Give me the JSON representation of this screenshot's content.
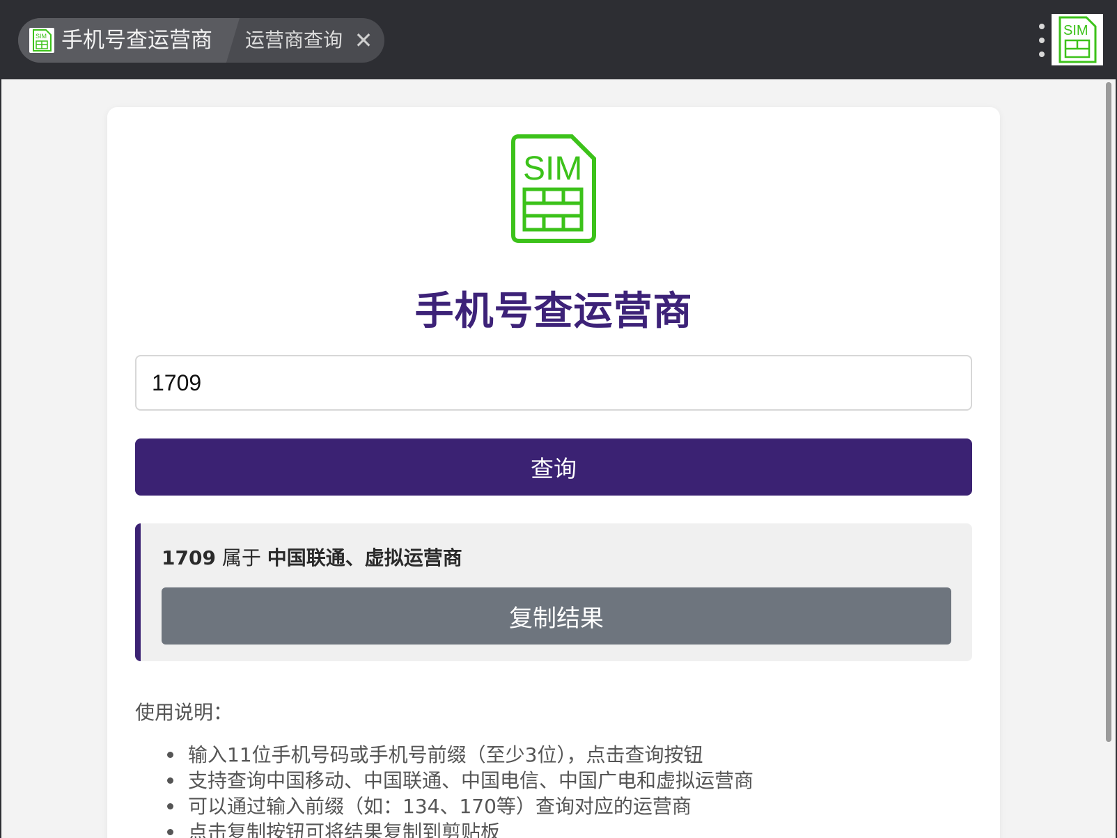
{
  "tabs": {
    "active_title": "手机号查运营商",
    "second_title": "运营商查询",
    "close_symbol": "✕"
  },
  "icons": {
    "sim_label": "SIM",
    "sim_color": "#3cc21a"
  },
  "colors": {
    "accent": "#3b2273",
    "title": "#3d2278",
    "copy_button": "#6e757e"
  },
  "main": {
    "title": "手机号查运营商",
    "input_value": "1709",
    "query_button": "查询",
    "result": {
      "prefix": "1709",
      "belongs_text": " 属于 ",
      "carrier": "中国联通、虚拟运营商"
    },
    "copy_button": "复制结果",
    "help_title": "使用说明：",
    "help_items": [
      "输入11位手机号码或手机号前缀（至少3位），点击查询按钮",
      "支持查询中国移动、中国联通、中国电信、中国广电和虚拟运营商",
      "可以通过输入前缀（如：134、170等）查询对应的运营商",
      "点击复制按钮可将结果复制到剪贴板"
    ]
  }
}
